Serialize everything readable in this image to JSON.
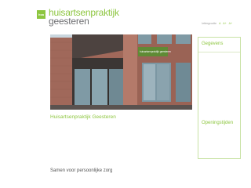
{
  "header": {
    "logo_mark": "hsa",
    "logo_line1": "huisartsenpraktijk",
    "logo_line2": "geesteren",
    "textsize_label": "lettergrootte",
    "textsize_options": [
      "A",
      "A+",
      "A+"
    ]
  },
  "main": {
    "caption": "Huisartsenpraktijk Geesteren",
    "tagline": "Samen voor persoonlijke zorg",
    "photo_sign": "huisartsenpraktijk geesteren"
  },
  "sidebar": {
    "heading1": "Gegevens",
    "heading2": "Openingstijden"
  },
  "colors": {
    "accent": "#8dc63f",
    "grey_text": "#6d6e71",
    "brick": "#a0685a"
  }
}
